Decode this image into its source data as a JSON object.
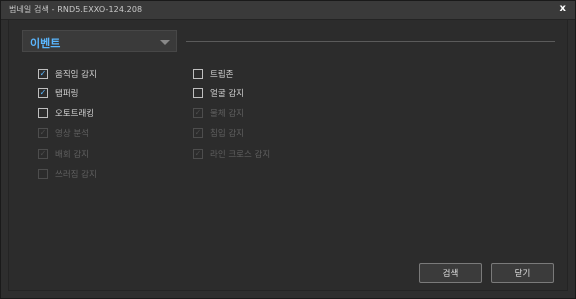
{
  "window": {
    "title": "범네일 검색 - RND5.EXXO-124.208",
    "close_label": "x"
  },
  "event_select": {
    "label": "이벤트"
  },
  "left_column": [
    {
      "label": "움직임 감지",
      "checked": true,
      "enabled": true
    },
    {
      "label": "탬퍼링",
      "checked": true,
      "enabled": true
    },
    {
      "label": "오토트래킹",
      "checked": false,
      "enabled": true
    },
    {
      "label": "영상 분석",
      "checked": true,
      "enabled": false
    },
    {
      "label": "배회 감지",
      "checked": true,
      "enabled": false
    },
    {
      "label": "쓰러짐 감지",
      "checked": false,
      "enabled": false
    }
  ],
  "right_column": [
    {
      "label": "트립존",
      "checked": false,
      "enabled": true
    },
    {
      "label": "얼굴 감지",
      "checked": false,
      "enabled": true
    },
    {
      "label": "물체 감지",
      "checked": true,
      "enabled": false
    },
    {
      "label": "침입 감지",
      "checked": true,
      "enabled": false
    },
    {
      "label": "라인 크로스 감지",
      "checked": true,
      "enabled": false
    }
  ],
  "buttons": {
    "search_label": "검색",
    "close_label": "닫기"
  },
  "colors": {
    "accent": "#5ab7ff",
    "background": "#2e2e2e"
  }
}
